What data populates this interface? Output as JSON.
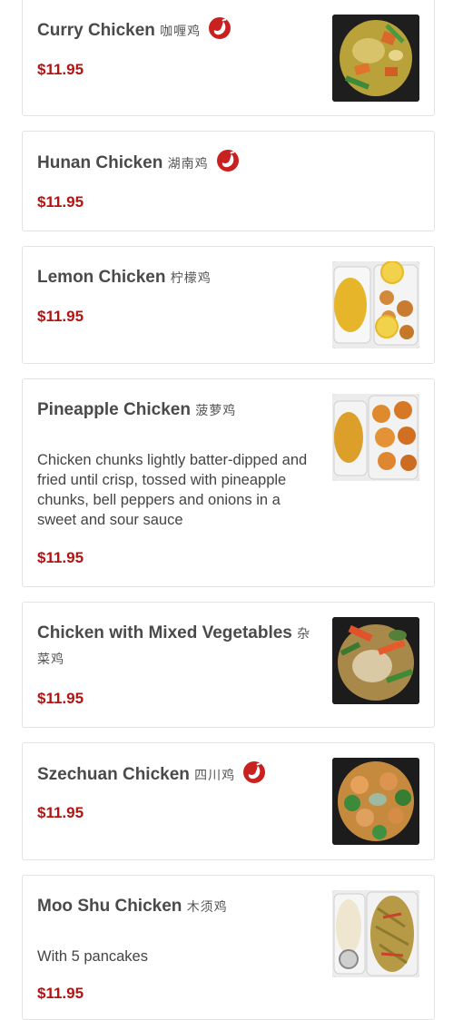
{
  "items": [
    {
      "name": "Curry Chicken",
      "chinese": "咖喱鸡",
      "spicy": true,
      "description": "",
      "price": "$11.95",
      "photo_icon": "curry-chicken-photo"
    },
    {
      "name": "Hunan Chicken",
      "chinese": "湖南鸡",
      "spicy": true,
      "description": "",
      "price": "$11.95",
      "photo_icon": ""
    },
    {
      "name": "Lemon Chicken",
      "chinese": "柠檬鸡",
      "spicy": false,
      "description": "",
      "price": "$11.95",
      "photo_icon": "lemon-chicken-photo"
    },
    {
      "name": "Pineapple Chicken",
      "chinese": "菠萝鸡",
      "spicy": false,
      "description": "Chicken chunks lightly batter-dipped and fried until crisp, tossed with pineapple chunks, bell peppers and onions in a sweet and sour sauce",
      "price": "$11.95",
      "photo_icon": "pineapple-chicken-photo"
    },
    {
      "name": "Chicken with Mixed Vegetables",
      "chinese": "杂菜鸡",
      "spicy": false,
      "description": "",
      "price": "$11.95",
      "photo_icon": "mixed-vegetables-chicken-photo"
    },
    {
      "name": "Szechuan Chicken",
      "chinese": "四川鸡",
      "spicy": true,
      "description": "",
      "price": "$11.95",
      "photo_icon": "szechuan-chicken-photo"
    },
    {
      "name": "Moo Shu Chicken",
      "chinese": "木须鸡",
      "spicy": false,
      "description": "With 5 pancakes",
      "price": "$11.95",
      "photo_icon": "moo-shu-chicken-photo"
    }
  ],
  "colors": {
    "price": "#b51212",
    "spicy": "#c8211f",
    "border": "#e3e3e3"
  }
}
